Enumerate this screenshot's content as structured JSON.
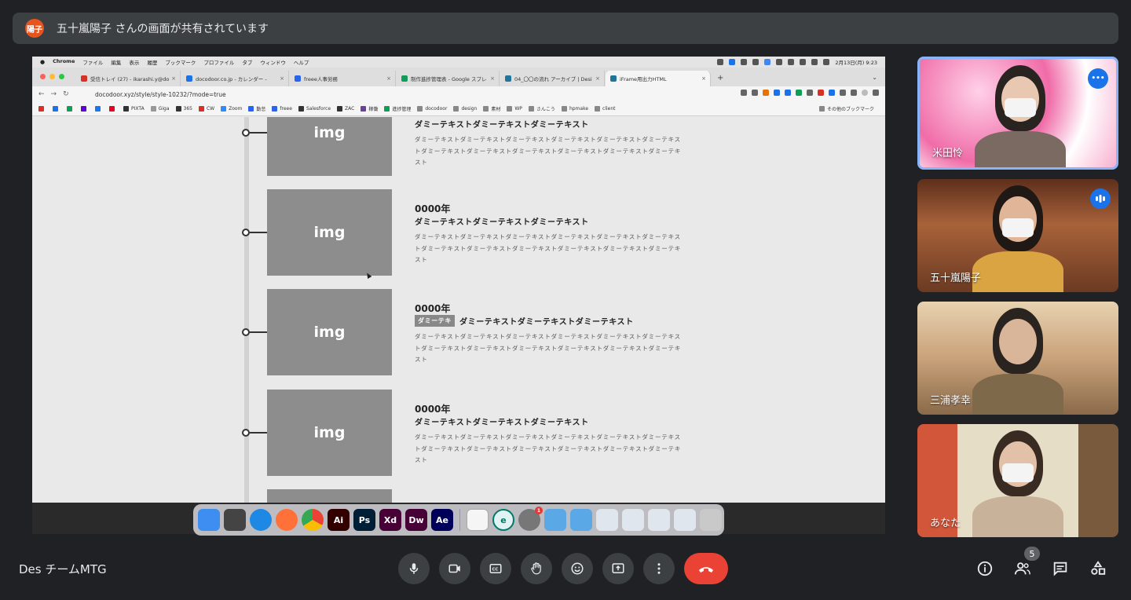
{
  "banner": {
    "avatar_label": "陽子",
    "text": "五十嵐陽子 さんの画面が共有されています"
  },
  "macbar": {
    "menus": [
      "Chrome",
      "ファイル",
      "編集",
      "表示",
      "履歴",
      "ブックマーク",
      "プロファイル",
      "タブ",
      "ウィンドウ",
      "ヘルプ"
    ],
    "clock": "2月13日(月) 9:23"
  },
  "browser": {
    "tabs": [
      {
        "label": "受信トレイ (27) - ikarashi.y@do",
        "color": "#d93025"
      },
      {
        "label": "docodoor.co.jp - カレンダー -",
        "color": "#1a73e8"
      },
      {
        "label": "freee人事労務",
        "color": "#2864f0"
      },
      {
        "label": "制作進捗管理表 - Google スプレ",
        "color": "#0f9d58"
      },
      {
        "label": "04_〇〇の流れ アーカイブ | Desi",
        "color": "#21759b"
      },
      {
        "label": "iFrame用出力HTML",
        "color": "#21759b"
      }
    ],
    "new_tab": "+",
    "url": "docodoor.xyz/style/style-10232/?mode=true",
    "bookmarks": [
      {
        "label": "",
        "color": "#d93025"
      },
      {
        "label": "",
        "color": "#1a73e8"
      },
      {
        "label": "",
        "color": "#0f9d58"
      },
      {
        "label": "",
        "color": "#6001d2"
      },
      {
        "label": "",
        "color": "#1877f2"
      },
      {
        "label": "",
        "color": "#e60023"
      },
      {
        "label": "PIXTA",
        "color": "#333333"
      },
      {
        "label": "Giga",
        "color": "#999999"
      },
      {
        "label": "365",
        "color": "#333333"
      },
      {
        "label": "CW",
        "color": "#d93025"
      },
      {
        "label": "Zoom",
        "color": "#2d8cff"
      },
      {
        "label": "勤怠",
        "color": "#2864f0"
      },
      {
        "label": "freee",
        "color": "#2864f0"
      },
      {
        "label": "Salesforce",
        "color": "#333333"
      },
      {
        "label": "ZAC",
        "color": "#333333"
      },
      {
        "label": "稼働",
        "color": "#6b3fa0"
      },
      {
        "label": "進捗管理",
        "color": "#0f9d58"
      },
      {
        "label": "docodoor",
        "color": "#888888"
      },
      {
        "label": "design",
        "color": "#888888"
      },
      {
        "label": "素材",
        "color": "#888888"
      },
      {
        "label": "WP",
        "color": "#888888"
      },
      {
        "label": "さんこう",
        "color": "#888888"
      },
      {
        "label": "hpmake",
        "color": "#888888"
      },
      {
        "label": "client",
        "color": "#888888"
      }
    ],
    "other_bookmarks": "その他のブックマーク"
  },
  "page": {
    "img_label": "img",
    "entries": [
      {
        "year": "",
        "tag": "",
        "title": "ダミーテキストダミーテキストダミーテキスト",
        "body": "ダミーテキストダミーテキストダミーテキストダミーテキストダミーテキストダミーテキストダミーテキストダミーテキストダミーテキストダミーテキストダミーテキストダミーテキスト"
      },
      {
        "year": "0000年",
        "tag": "",
        "title": "ダミーテキストダミーテキストダミーテキスト",
        "body": "ダミーテキストダミーテキストダミーテキストダミーテキストダミーテキストダミーテキストダミーテキストダミーテキストダミーテキストダミーテキストダミーテキストダミーテキスト"
      },
      {
        "year": "0000年",
        "tag": "ダミーテキ",
        "title": "ダミーテキストダミーテキストダミーテキスト",
        "body": "ダミーテキストダミーテキストダミーテキストダミーテキストダミーテキストダミーテキストダミーテキストダミーテキストダミーテキストダミーテキストダミーテキストダミーテキスト"
      },
      {
        "year": "0000年",
        "tag": "",
        "title": "ダミーテキストダミーテキストダミーテキスト",
        "body": "ダミーテキストダミーテキストダミーテキストダミーテキストダミーテキストダミーテキストダミーテキストダミーテキストダミーテキストダミーテキストダミーテキストダミーテキスト"
      }
    ]
  },
  "dock": {
    "apps": [
      {
        "label": "",
        "icon": "finder-icon",
        "color": "#3d8ef0"
      },
      {
        "label": "",
        "icon": "calculator-icon",
        "color": "#444444"
      },
      {
        "label": "",
        "icon": "safari-icon",
        "color": "#1e88e5"
      },
      {
        "label": "",
        "icon": "firefox-icon",
        "color": "#ff7139"
      },
      {
        "label": "",
        "icon": "chrome-icon",
        "color": "#ffffff"
      },
      {
        "label": "Ai",
        "icon": "illustrator-icon",
        "color": "#330000"
      },
      {
        "label": "Ps",
        "icon": "photoshop-icon",
        "color": "#001e36"
      },
      {
        "label": "Xd",
        "icon": "xd-icon",
        "color": "#470137"
      },
      {
        "label": "Dw",
        "icon": "dreamweaver-icon",
        "color": "#470137"
      },
      {
        "label": "Ae",
        "icon": "after-effects-icon",
        "color": "#00005b"
      },
      {
        "label": "",
        "icon": "textedit-icon",
        "color": "#f5f5f5"
      },
      {
        "label": "e",
        "icon": "edge-e-icon",
        "color": "#e0f2f1"
      },
      {
        "label": "",
        "icon": "system-preferences-icon",
        "color": "#777777"
      }
    ],
    "notification_count": "1"
  },
  "participants": [
    {
      "name": "米田怜",
      "skin": "#e8c8b0",
      "hair": "#2a2420",
      "shirt": "#7a6a62",
      "bg": "#f3b7c9",
      "indicator": "more-options-icon"
    },
    {
      "name": "五十嵐陽子",
      "skin": "#e0b598",
      "hair": "#1f1814",
      "shirt": "#d9a441",
      "bg": "#8a4a2c",
      "indicator": "speaking-bars-icon"
    },
    {
      "name": "三浦孝幸",
      "skin": "#d9b59a",
      "hair": "#2a2420",
      "shirt": "#7e6a4a",
      "bg": "#d9b98e",
      "indicator": ""
    },
    {
      "name": "あなた",
      "skin": "#e3c0a8",
      "hair": "#3a2b22",
      "shirt": "#c8b39a",
      "bg": "#7a5a3c",
      "indicator": ""
    }
  ],
  "meeting": {
    "name": "Des チームMTG",
    "participant_count": "5"
  },
  "colors": {
    "hangup": "#ea4335",
    "accent": "#8ab4f8",
    "surface": "#3c4043"
  }
}
